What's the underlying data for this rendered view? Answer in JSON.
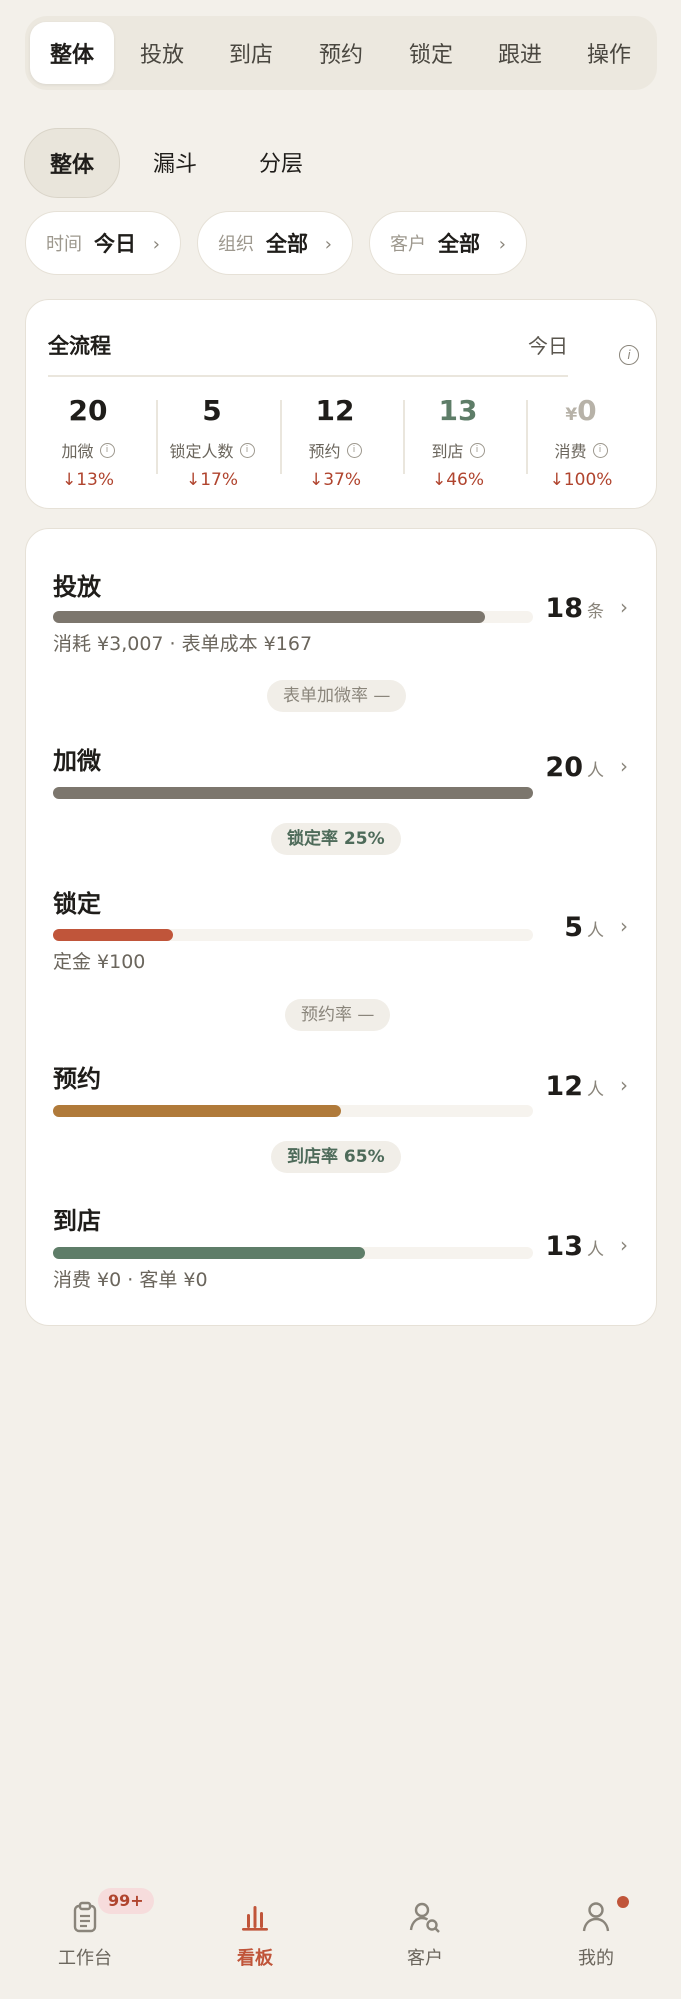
{
  "top_tabs": [
    "整体",
    "投放",
    "到店",
    "预约",
    "锁定",
    "跟进",
    "操作"
  ],
  "segments": [
    "整体",
    "漏斗",
    "分层"
  ],
  "filters": [
    {
      "label": "时间",
      "value": "今日"
    },
    {
      "label": "组织",
      "value": "全部"
    },
    {
      "label": "客户",
      "value": "全部"
    }
  ],
  "summary": {
    "title": "全流程",
    "date": "今日",
    "metrics": [
      {
        "value": "20",
        "name": "加微",
        "change": "↓13%"
      },
      {
        "value": "5",
        "name": "锁定人数",
        "change": "↓17%"
      },
      {
        "value": "12",
        "name": "预约",
        "change": "↓37%"
      },
      {
        "value": "13",
        "name": "到店",
        "change": "↓46%"
      },
      {
        "value_prefix": "¥",
        "value": "0",
        "name": "消费",
        "change": "↓100%"
      }
    ]
  },
  "funnel": {
    "stages": [
      {
        "title": "投放",
        "count": "18",
        "unit": "条",
        "fraction": 0.9,
        "color": "#7C766D",
        "sub": "消耗 ¥3,007 · 表单成本 ¥167"
      },
      {
        "title": "加微",
        "count": "20",
        "unit": "人",
        "fraction": 1.0,
        "color": "#7C766D",
        "sub": ""
      },
      {
        "title": "锁定",
        "count": "5",
        "unit": "人",
        "fraction": 0.25,
        "color": "#C0553A",
        "sub": "定金 ¥100"
      },
      {
        "title": "预约",
        "count": "12",
        "unit": "人",
        "fraction": 0.6,
        "color": "#B07A3A",
        "sub": ""
      },
      {
        "title": "到店",
        "count": "13",
        "unit": "人",
        "fraction": 0.65,
        "color": "#5E7D68",
        "sub": "消费 ¥0 · 客单 ¥0"
      }
    ],
    "rates": [
      "表单加微率 —",
      "锁定率 25%",
      "预约率 —",
      "到店率 65%"
    ]
  },
  "bottom_nav": {
    "items": [
      "工作台",
      "看板",
      "客户",
      "我的"
    ],
    "badge": "99+"
  }
}
